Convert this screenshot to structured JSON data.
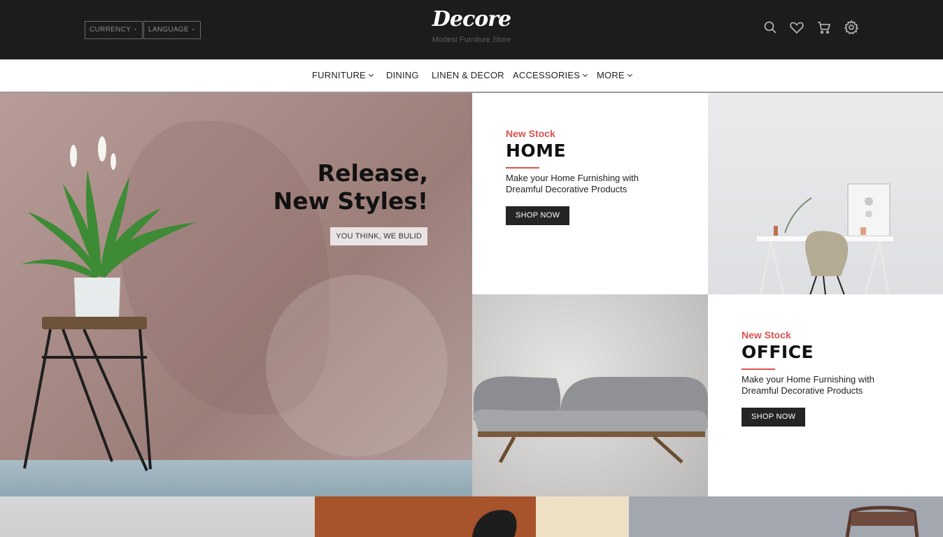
{
  "header": {
    "currency_label": "CURRENCY",
    "language_label": "LANGUAGE",
    "logo_text": "Decore",
    "tagline": "Modest Furniture Store",
    "icons": [
      "search-icon",
      "heart-icon",
      "cart-icon",
      "gear-icon"
    ]
  },
  "nav": {
    "items": [
      {
        "label": "FURNITURE",
        "dropdown": true
      },
      {
        "label": "DINING",
        "dropdown": false
      },
      {
        "label": "LINEN & DECOR",
        "dropdown": false
      },
      {
        "label": "ACCESSORIES",
        "dropdown": true
      },
      {
        "label": "MORE",
        "dropdown": true
      }
    ]
  },
  "hero": {
    "title_line1": "Release,",
    "title_line2": "New Styles!",
    "tag": "YOU THINK, WE BULID"
  },
  "promos": [
    {
      "eyebrow": "New Stock",
      "title": "HOME",
      "description": "Make your Home Furnishing with Dreamful Decorative Products",
      "button": "SHOP NOW"
    },
    {
      "eyebrow": "New Stock",
      "title": "OFFICE",
      "description": "Make your Home Furnishing with Dreamful Decorative Products",
      "button": "SHOP NOW"
    }
  ],
  "colors": {
    "topbar": "#1c1c1c",
    "accent": "#d9534f",
    "button": "#252525"
  }
}
